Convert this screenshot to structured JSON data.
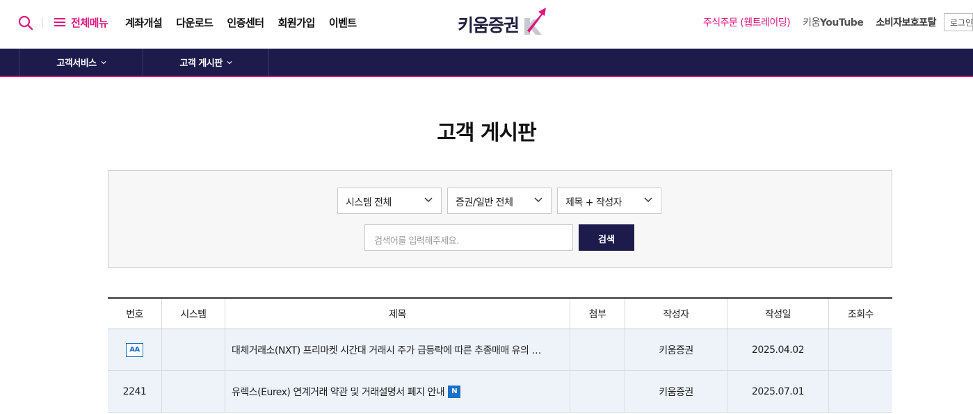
{
  "header": {
    "menu_label": "전체메뉴",
    "gnb": [
      "계좌개설",
      "다운로드",
      "인증센터",
      "회원가입",
      "이벤트"
    ],
    "logo_text": "키움증권",
    "order_link": "주식주문 (웹트레이딩)",
    "youtube_prefix": "키움",
    "youtube_suffix": "YouTube",
    "portal_link": "소비자보호포탈",
    "login_label": "로그인"
  },
  "nav": {
    "items": [
      "고객서비스",
      "고객 게시판"
    ]
  },
  "page": {
    "title": "고객 게시판"
  },
  "search": {
    "system_select": "시스템 전체",
    "category_select": "증권/일반 전체",
    "field_select": "제목 + 작성자",
    "keyword_placeholder": "검색어를 입력해주세요.",
    "submit_label": "검색"
  },
  "table": {
    "headers": [
      "번호",
      "시스템",
      "제목",
      "첨부",
      "작성자",
      "작성일",
      "조회수"
    ],
    "rows": [
      {
        "no": "",
        "badge": "AA",
        "system": "",
        "title": "대체거래소(NXT) 프리마켓 시간대 거래시 주가 급등락에 따른 추종매매 유의 …",
        "new_badge": "",
        "attachment": "",
        "writer": "키움증권",
        "date": "2025.04.02",
        "views": ""
      },
      {
        "no": "2241",
        "badge": "",
        "system": "",
        "title": "유렉스(Eurex) 연계거래 약관 및 거래설명서 폐지 안내",
        "new_badge": "N",
        "attachment": "",
        "writer": "키움증권",
        "date": "2025.07.01",
        "views": ""
      }
    ]
  },
  "colors": {
    "accent": "#e0157f",
    "navy": "#1c1b4c",
    "badge_blue": "#1a6fc9",
    "row_highlight": "#eef3fa"
  }
}
